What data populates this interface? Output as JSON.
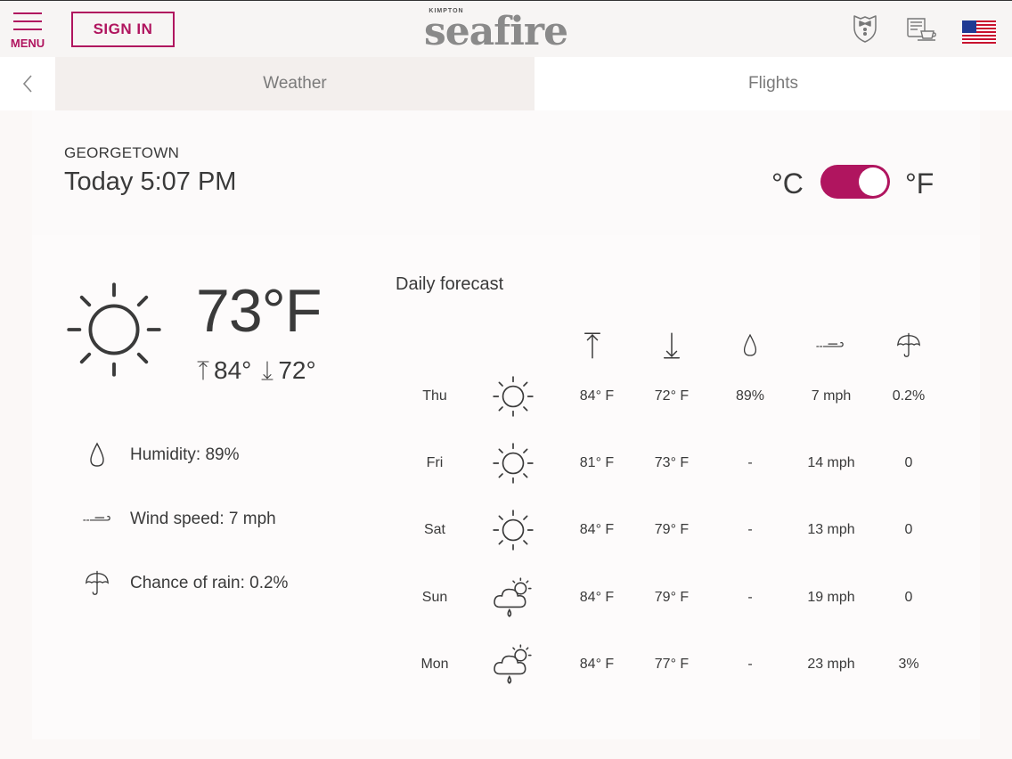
{
  "header": {
    "menu_label": "MENU",
    "signin_label": "SIGN IN",
    "logo_small": "KIMPTON",
    "logo_main": "seafire",
    "icons": [
      "menu-icon",
      "concierge-icon",
      "newspaper-coffee-icon",
      "us-flag-icon"
    ]
  },
  "tabs": [
    {
      "label": "Weather",
      "active": true
    },
    {
      "label": "Flights",
      "active": false
    }
  ],
  "location": {
    "city": "GEORGETOWN",
    "datetime": "Today 5:07 PM"
  },
  "units": {
    "celsius_label": "°C",
    "fahrenheit_label": "°F",
    "selected": "F"
  },
  "current": {
    "temp": "73°F",
    "high": "84°",
    "low": "72°",
    "humidity": "Humidity: 89%",
    "wind": "Wind speed: 7 mph",
    "rain": "Chance of rain: 0.2%"
  },
  "forecast": {
    "title": "Daily forecast",
    "columns": [
      "high-temp-icon",
      "low-temp-icon",
      "humidity-icon",
      "wind-icon",
      "rain-icon"
    ],
    "days": [
      {
        "day": "Thu",
        "icon": "sun",
        "high": "84° F",
        "low": "72° F",
        "humidity": "89%",
        "wind": "7 mph",
        "rain": "0.2%"
      },
      {
        "day": "Fri",
        "icon": "sun",
        "high": "81° F",
        "low": "73° F",
        "humidity": "-",
        "wind": "14 mph",
        "rain": "0"
      },
      {
        "day": "Sat",
        "icon": "sun",
        "high": "84° F",
        "low": "79° F",
        "humidity": "-",
        "wind": "13 mph",
        "rain": "0"
      },
      {
        "day": "Sun",
        "icon": "sun-cloud-rain",
        "high": "84° F",
        "low": "79° F",
        "humidity": "-",
        "wind": "19 mph",
        "rain": "0"
      },
      {
        "day": "Mon",
        "icon": "sun-cloud-rain",
        "high": "84° F",
        "low": "77° F",
        "humidity": "-",
        "wind": "23 mph",
        "rain": "3%"
      }
    ]
  },
  "colors": {
    "accent": "#b0155f",
    "text": "#3a3a3a",
    "muted": "#7a7a7a"
  }
}
